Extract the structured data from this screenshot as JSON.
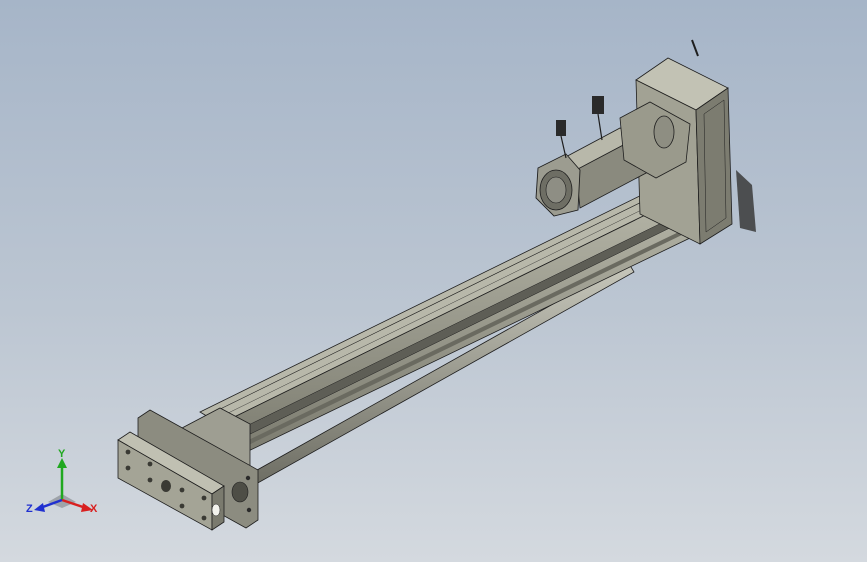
{
  "viewport": {
    "background_top": "#a6b5c8",
    "background_bottom": "#d4d9df",
    "model_color": "#9a9a8a",
    "edge_color": "#1e1e1e"
  },
  "triad": {
    "x_label": "X",
    "y_label": "Y",
    "z_label": "Z",
    "x_color": "#d82020",
    "y_color": "#20a820",
    "z_color": "#2030d0"
  }
}
